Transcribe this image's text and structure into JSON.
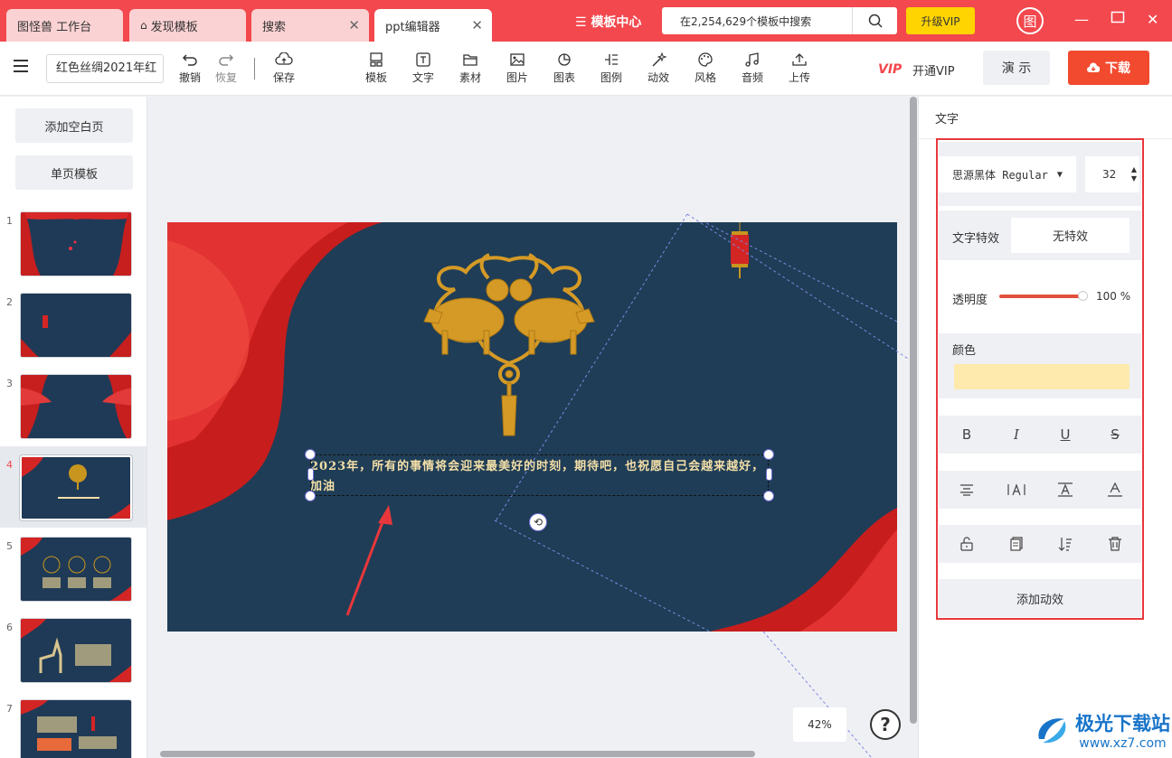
{
  "tabs": [
    {
      "label": "图怪兽  工作台"
    },
    {
      "label": "发现模板"
    },
    {
      "label": "搜索"
    },
    {
      "label": "ppt编辑器"
    }
  ],
  "header": {
    "template_center": "模板中心",
    "search_placeholder": "在2,254,629个模板中搜索",
    "upgrade_vip": "升级VIP",
    "logo_char": "图"
  },
  "toolbar": {
    "doc_name": "红色丝绸2021年红",
    "undo": "撤销",
    "redo": "恢复",
    "save": "保存",
    "template": "模板",
    "text": "文字",
    "material": "素材",
    "image": "图片",
    "chart": "图表",
    "legend": "图例",
    "animation": "动效",
    "style": "风格",
    "audio": "音频",
    "upload": "上传",
    "vip_logo": "VIP",
    "open_vip": "开通VIP",
    "present": "演 示",
    "download": "下载"
  },
  "left_panel": {
    "add_blank": "添加空白页",
    "single_template": "单页模板",
    "slides": [
      {
        "num": "1"
      },
      {
        "num": "2"
      },
      {
        "num": "3"
      },
      {
        "num": "4"
      },
      {
        "num": "5"
      },
      {
        "num": "6"
      },
      {
        "num": "7"
      }
    ]
  },
  "canvas": {
    "text": "2023年，所有的事情将会迎来最美好的时刻，期待吧，也祝愿自己会越来越好，加油",
    "zoom": "42%",
    "help": "?"
  },
  "right_panel": {
    "title": "文字",
    "font_name": "思源黑体 Regular",
    "font_size": "32",
    "effect_label": "文字特效",
    "effect_value": "无特效",
    "opacity_label": "透明度",
    "opacity_value": "100 %",
    "opacity": 1.0,
    "color_label": "颜色",
    "color_value": "#fdeaac",
    "add_animation": "添加动效"
  },
  "watermark": {
    "brand": "极光下载站",
    "url": "www.xz7.com"
  },
  "colors": {
    "brand_red": "#f2484e",
    "download_orange": "#f24a2f",
    "vip_yellow": "#ffd400",
    "slide_bg": "#1f3d56",
    "slide_text": "#f4dfa8",
    "highlight_box": "#e8373c"
  },
  "icons": [
    "menu-icon",
    "undo-icon",
    "redo-icon",
    "cloud-save-icon",
    "template-icon",
    "text-icon",
    "folder-icon",
    "image-icon",
    "chart-icon",
    "legend-icon",
    "magic-wand-icon",
    "palette-icon",
    "music-icon",
    "upload-icon",
    "search-icon",
    "home-icon",
    "close-icon",
    "minimize-icon",
    "maximize-icon",
    "bold-icon",
    "italic-icon",
    "underline-icon",
    "strikethrough-icon",
    "align-center-icon",
    "letter-spacing-icon",
    "line-height-icon",
    "text-color-icon",
    "unlock-icon",
    "copy-icon",
    "sort-icon",
    "trash-icon"
  ]
}
